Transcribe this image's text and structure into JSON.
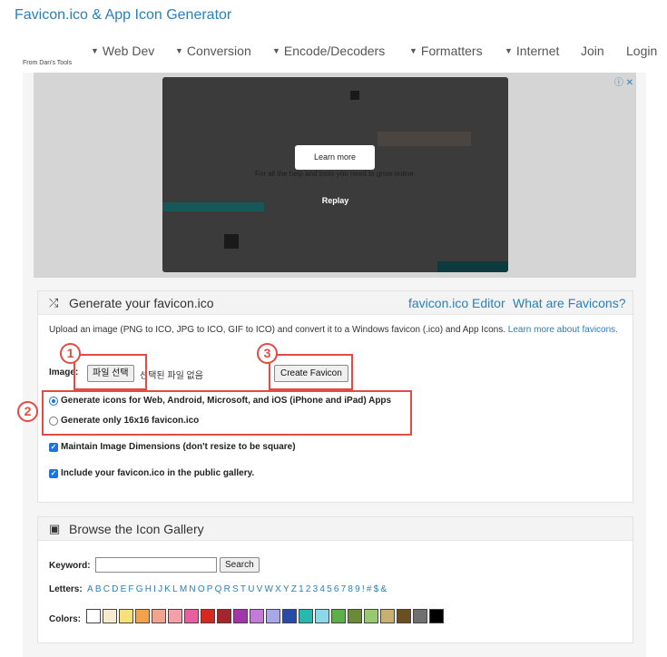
{
  "site": {
    "title": "Favicon.ico & App Icon Generator",
    "from": "From Dan's Tools"
  },
  "nav": {
    "items": [
      {
        "label": "Web Dev",
        "dropdown": true
      },
      {
        "label": "Conversion",
        "dropdown": true
      },
      {
        "label": "Encode/Decoders",
        "dropdown": true
      },
      {
        "label": "Formatters",
        "dropdown": true
      },
      {
        "label": "Internet",
        "dropdown": true
      },
      {
        "label": "Join",
        "dropdown": false
      },
      {
        "label": "Login",
        "dropdown": false
      }
    ]
  },
  "ad": {
    "info": "ⓘ ✕",
    "learn_more": "Learn more",
    "tagline": "For all the help and tools you need to grow online.",
    "replay": "Replay"
  },
  "generate": {
    "title": "Generate your favicon.ico",
    "link1": "favicon.ico Editor",
    "link2": "What are Favicons?",
    "description": "Upload an image (PNG to ICO, JPG to ICO, GIF to ICO) and convert it to a Windows favicon (.ico) and App Icons.",
    "learn_more": "Learn more about favicons.",
    "image_label": "Image:",
    "file_button": "파일 선택",
    "file_status": "선택된 파일 없음",
    "create_button": "Create Favicon",
    "options": [
      {
        "label": "Generate icons for Web, Android, Microsoft, and iOS (iPhone and iPad) Apps",
        "type": "radio",
        "selected": true
      },
      {
        "label": "Generate only 16x16 favicon.ico",
        "type": "radio",
        "selected": false
      },
      {
        "label": "Maintain Image Dimensions (don't resize to be square)",
        "type": "checkbox",
        "checked": true
      },
      {
        "label": "Include your favicon.ico in the public gallery.",
        "type": "checkbox",
        "checked": true
      }
    ]
  },
  "gallery": {
    "title": "Browse the Icon Gallery",
    "keyword_label": "Keyword:",
    "keyword_value": "",
    "search_button": "Search",
    "letters_label": "Letters:",
    "letters": [
      "A",
      "B",
      "C",
      "D",
      "E",
      "F",
      "G",
      "H",
      "I",
      "J",
      "K",
      "L",
      "M",
      "N",
      "O",
      "P",
      "Q",
      "R",
      "S",
      "T",
      "U",
      "V",
      "W",
      "X",
      "Y",
      "Z",
      "1",
      "2",
      "3",
      "4",
      "5",
      "6",
      "7",
      "8",
      "9",
      "!",
      "#",
      "$",
      "&"
    ],
    "colors_label": "Colors:",
    "colors": [
      "#ffffff",
      "#f5ecd0",
      "#f7e07a",
      "#f2a24b",
      "#f1a58f",
      "#f4a0a8",
      "#e85fa0",
      "#d8271e",
      "#a4262c",
      "#a236a8",
      "#c47ad8",
      "#a8a8e8",
      "#2a4aa8",
      "#28b8b0",
      "#8ad8e8",
      "#5cb048",
      "#6a8a3a",
      "#9ac870",
      "#c8b070",
      "#6a5020",
      "#707070",
      "#000000"
    ]
  },
  "annotations": [
    "1",
    "2",
    "3"
  ]
}
